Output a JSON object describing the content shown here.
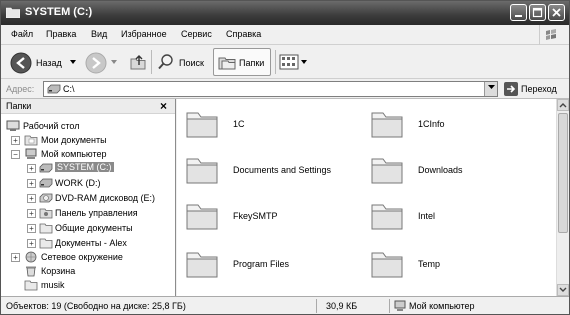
{
  "window": {
    "title": "SYSTEM (C:)"
  },
  "menu": [
    "Файл",
    "Правка",
    "Вид",
    "Избранное",
    "Сервис",
    "Справка"
  ],
  "toolbar": {
    "back_label": "Назад",
    "search_label": "Поиск",
    "folders_label": "Папки"
  },
  "address": {
    "label": "Адрес:",
    "value": "C:\\",
    "go_label": "Переход"
  },
  "folders_panel": {
    "title": "Папки",
    "close": "×",
    "items": [
      {
        "label": "Рабочий стол",
        "icon": "desktop-icon"
      },
      {
        "label": "Мои документы",
        "icon": "my-documents-icon"
      },
      {
        "label": "Мой компьютер",
        "icon": "my-computer-icon"
      },
      {
        "label": "SYSTEM (C:)",
        "icon": "hard-drive-icon"
      },
      {
        "label": "WORK (D:)",
        "icon": "hard-drive-icon"
      },
      {
        "label": "DVD-RAM дисковод (E:)",
        "icon": "dvd-drive-icon"
      },
      {
        "label": "Панель управления",
        "icon": "control-panel-icon"
      },
      {
        "label": "Общие документы",
        "icon": "folder-icon"
      },
      {
        "label": "Документы - Alex",
        "icon": "folder-icon"
      },
      {
        "label": "Сетевое окружение",
        "icon": "network-icon"
      },
      {
        "label": "Корзина",
        "icon": "recycle-bin-icon"
      },
      {
        "label": "musik",
        "icon": "folder-icon"
      }
    ]
  },
  "files": [
    {
      "name": "1C"
    },
    {
      "name": "1CInfo"
    },
    {
      "name": "Documents and Settings"
    },
    {
      "name": "Downloads"
    },
    {
      "name": "FkeySMTP"
    },
    {
      "name": "Intel"
    },
    {
      "name": "Program Files"
    },
    {
      "name": "Temp"
    }
  ],
  "status": {
    "objects": "Объектов: 19 (Свободно на диске: 25,8 ГБ)",
    "size": "30,9 КБ",
    "location": "Мой компьютер"
  }
}
